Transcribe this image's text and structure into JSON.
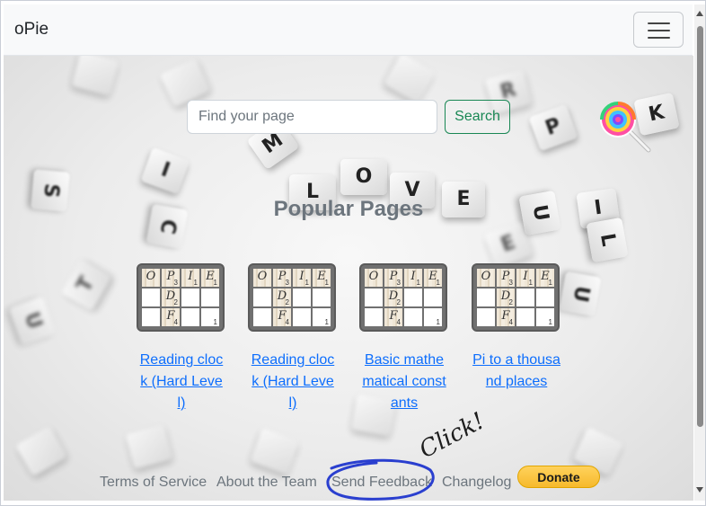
{
  "navbar": {
    "brand": "oPie",
    "menu_icon": "hamburger-icon"
  },
  "search": {
    "placeholder": "Find your page",
    "value": "",
    "button_label": "Search"
  },
  "lollipop": {
    "icon": "lollipop-icon"
  },
  "section_title": "Popular Pages",
  "carousel": {
    "prev_icon": "chevron-left-icon",
    "next_icon": "chevron-right-icon"
  },
  "card_grid": {
    "rows": [
      [
        "O",
        "P",
        "I",
        "E"
      ],
      [
        "",
        "D",
        "",
        ""
      ],
      [
        "",
        "F",
        "",
        ""
      ]
    ],
    "subscripts": {
      "0_1": "3",
      "0_2": "1",
      "0_3": "1",
      "1_1": "2",
      "2_1": "4",
      "2_3": "1"
    }
  },
  "cards": [
    {
      "label": "Reading clock (Hard Level)"
    },
    {
      "label": "Reading clock (Hard Level)"
    },
    {
      "label": "Basic mathematical constants"
    },
    {
      "label": "Pi to a thousand places"
    }
  ],
  "footer": {
    "links": [
      "Terms of Service",
      "About the Team",
      "Send Feedback",
      "Changelog"
    ],
    "donate_label": "Donate"
  },
  "annotation": {
    "text": "Click!",
    "color": "#2a3fcf"
  },
  "colors": {
    "link": "#0d6efd",
    "search_button": "#198754",
    "donate": "#ffc439"
  }
}
